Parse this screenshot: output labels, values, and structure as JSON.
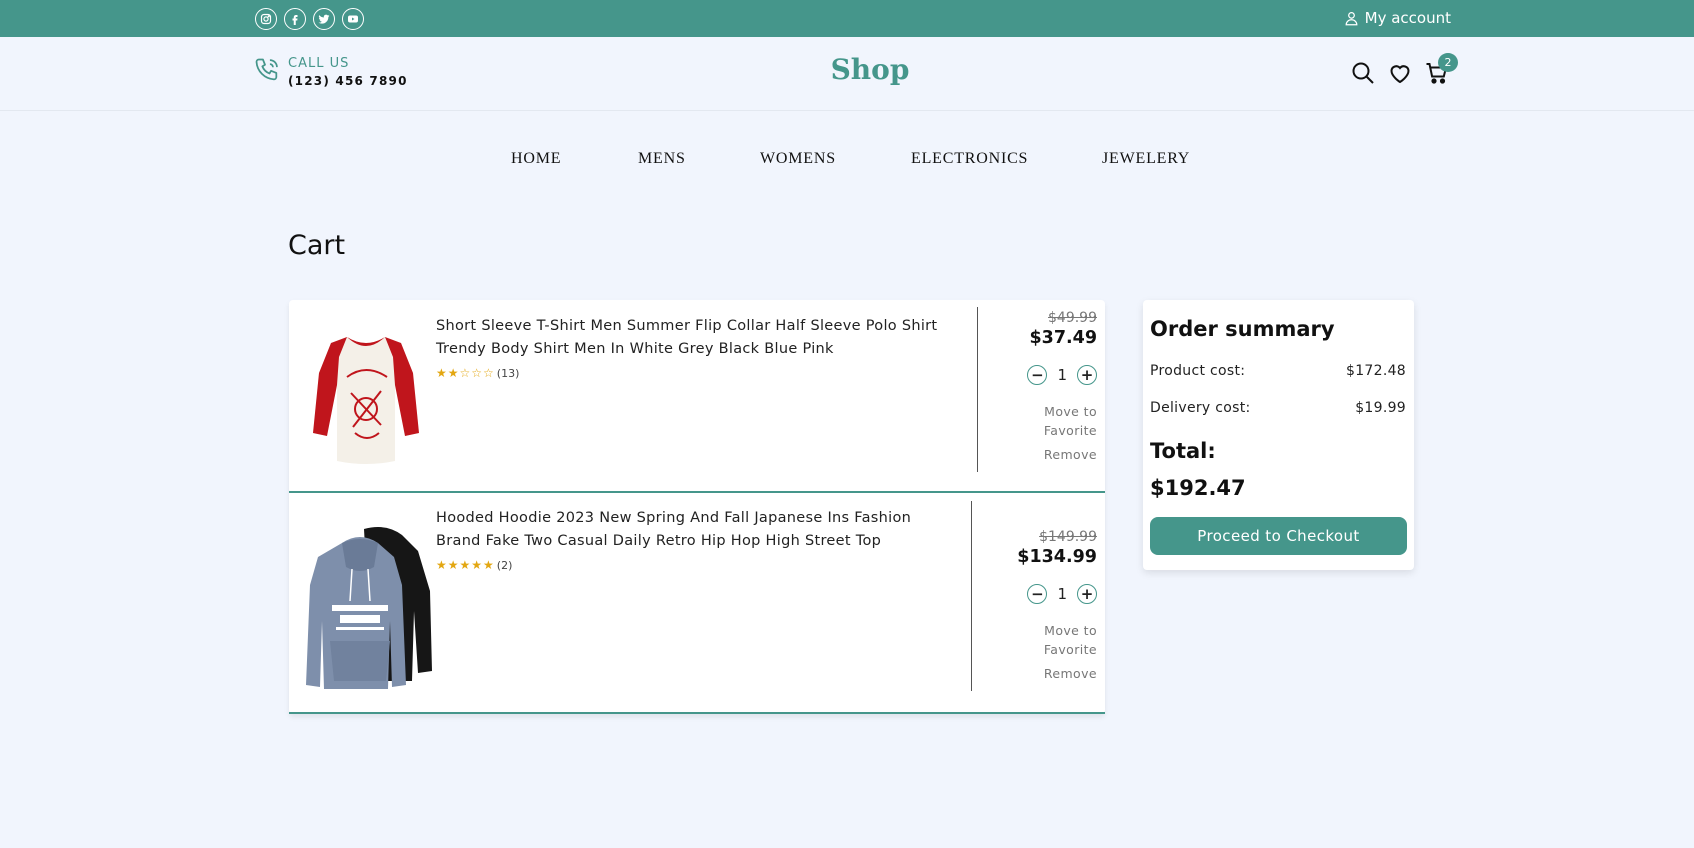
{
  "topbar": {
    "social_icons": [
      "instagram-icon",
      "facebook-icon",
      "twitter-icon",
      "youtube-icon"
    ],
    "account_label": "My account"
  },
  "header": {
    "call_label": "CALL US",
    "phone": "(123) 456 7890",
    "logo": "Shop",
    "cart_count": "2"
  },
  "nav": {
    "items": [
      "HOME",
      "MENS",
      "WOMENS",
      "ELECTRONICS",
      "JEWELERY"
    ]
  },
  "cart": {
    "title": "Cart",
    "items": [
      {
        "title": "Short Sleeve T-Shirt Men Summer Flip Collar Half Sleeve Polo Shirt Trendy Body Shirt Men In White Grey Black Blue Pink",
        "stars": "★★☆☆☆",
        "rating_value": 2,
        "reviews": "(13)",
        "old_price": "$49.99",
        "price": "$37.49",
        "quantity": "1",
        "move_label": "Move to Favorite",
        "remove_label": "Remove"
      },
      {
        "title": "Hooded Hoodie 2023 New Spring And Fall Japanese Ins Fashion Brand Fake Two Casual Daily Retro Hip Hop High Street Top",
        "stars": "★★★★★",
        "rating_value": 5,
        "reviews": "(2)",
        "old_price": "$149.99",
        "price": "$134.99",
        "quantity": "1",
        "move_label": "Move to Favorite",
        "remove_label": "Remove"
      }
    ]
  },
  "summary": {
    "title": "Order summary",
    "product_cost_label": "Product cost:",
    "product_cost": "$172.48",
    "delivery_cost_label": "Delivery cost:",
    "delivery_cost": "$19.99",
    "total_label": "Total:",
    "total": "$192.47",
    "checkout_label": "Proceed to Checkout"
  },
  "colors": {
    "accent": "#45968b",
    "background": "#f1f5fd",
    "star": "#e3a712"
  }
}
